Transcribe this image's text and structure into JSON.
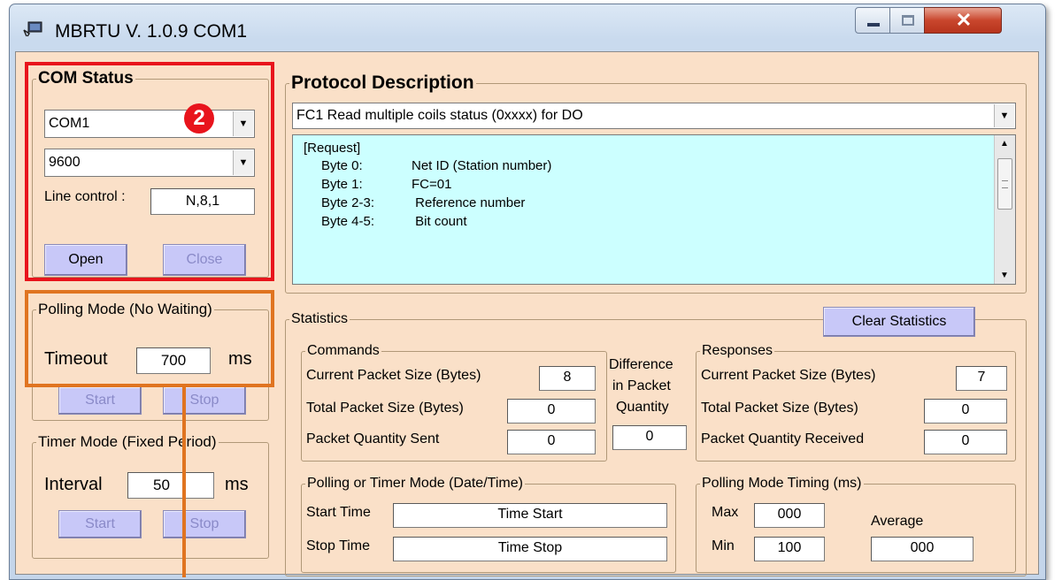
{
  "window": {
    "title": "MBRTU  V. 1.0.9  COM1"
  },
  "com_status": {
    "legend": "COM Status",
    "port": "COM1",
    "baud": "9600",
    "line_control_label": "Line control :",
    "line_control_value": "N,8,1",
    "open_label": "Open",
    "close_label": "Close",
    "badge": "2"
  },
  "polling_mode": {
    "legend": "Polling Mode (No Waiting)",
    "timeout_label": "Timeout",
    "timeout_value": "700",
    "unit": "ms",
    "start_label": "Start",
    "stop_label": "Stop"
  },
  "timer_mode": {
    "legend": "Timer Mode (Fixed Period)",
    "interval_label": "Interval",
    "interval_value": "50",
    "unit": "ms",
    "start_label": "Start",
    "stop_label": "Stop"
  },
  "protocol": {
    "legend": "Protocol Description",
    "function": "FC1  Read multiple coils status (0xxxx)  for DO",
    "description": {
      "header": "[Request]",
      "lines": [
        {
          "key": "Byte 0:",
          "value": "Net ID (Station number)"
        },
        {
          "key": "Byte 1:",
          "value": "FC=01"
        },
        {
          "key": "Byte 2-3:",
          "value": " Reference number"
        },
        {
          "key": "Byte 4-5:",
          "value": " Bit count"
        }
      ]
    }
  },
  "statistics": {
    "legend": "Statistics",
    "clear_label": "Clear Statistics",
    "commands": {
      "legend": "Commands",
      "current_label": "Current Packet Size (Bytes)",
      "current_value": "8",
      "total_label": "Total Packet Size (Bytes)",
      "total_value": "0",
      "quantity_label": "Packet Quantity Sent",
      "quantity_value": "0"
    },
    "difference": {
      "line1": "Difference",
      "line2": "in Packet",
      "line3": "Quantity",
      "value": "0"
    },
    "responses": {
      "legend": "Responses",
      "current_label": "Current Packet Size (Bytes)",
      "current_value": "7",
      "total_label": "Total Packet Size (Bytes)",
      "total_value": "0",
      "quantity_label": "Packet Quantity Received",
      "quantity_value": "0"
    },
    "datetime": {
      "legend": "Polling  or Timer Mode  (Date/Time)",
      "start_label": "Start Time",
      "start_value": "Time Start",
      "stop_label": "Stop Time",
      "stop_value": "Time Stop"
    },
    "timing": {
      "legend": "Polling Mode Timing (ms)",
      "max_label": "Max",
      "max_value": "000",
      "min_label": "Min",
      "min_value": "100",
      "avg_label": "Average",
      "avg_value": "000"
    }
  },
  "colors": {
    "client_bg": "#fae0c8",
    "desc_bg": "#ccffff",
    "button_bg": "#c8c8f8",
    "annotation_red": "#e8141c",
    "annotation_orange": "#e07420"
  }
}
